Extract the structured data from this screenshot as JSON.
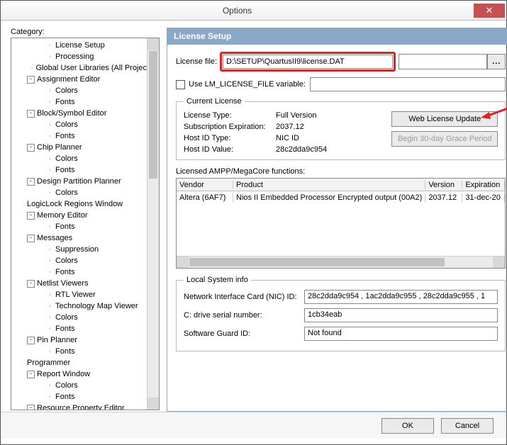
{
  "window": {
    "title": "Options"
  },
  "left": {
    "label": "Category:",
    "items": [
      {
        "level": 3,
        "exp": null,
        "label": "License Setup"
      },
      {
        "level": 3,
        "exp": null,
        "label": "Processing"
      },
      {
        "level": 3,
        "exp": null,
        "label": "Global User Libraries (All Projec"
      },
      {
        "level": 1,
        "exp": "-",
        "label": "Assignment Editor"
      },
      {
        "level": 3,
        "exp": null,
        "label": "Colors"
      },
      {
        "level": 3,
        "exp": null,
        "label": "Fonts"
      },
      {
        "level": 1,
        "exp": "-",
        "label": "Block/Symbol Editor"
      },
      {
        "level": 3,
        "exp": null,
        "label": "Colors"
      },
      {
        "level": 3,
        "exp": null,
        "label": "Fonts"
      },
      {
        "level": 1,
        "exp": "-",
        "label": "Chip Planner"
      },
      {
        "level": 3,
        "exp": null,
        "label": "Colors"
      },
      {
        "level": 3,
        "exp": null,
        "label": "Fonts"
      },
      {
        "level": 1,
        "exp": "-",
        "label": "Design Partition Planner"
      },
      {
        "level": 3,
        "exp": null,
        "label": "Colors"
      },
      {
        "level": 1,
        "exp": null,
        "label": "LogicLock Regions Window"
      },
      {
        "level": 1,
        "exp": "-",
        "label": "Memory Editor"
      },
      {
        "level": 3,
        "exp": null,
        "label": "Fonts"
      },
      {
        "level": 1,
        "exp": "-",
        "label": "Messages"
      },
      {
        "level": 3,
        "exp": null,
        "label": "Suppression"
      },
      {
        "level": 3,
        "exp": null,
        "label": "Colors"
      },
      {
        "level": 3,
        "exp": null,
        "label": "Fonts"
      },
      {
        "level": 1,
        "exp": "-",
        "label": "Netlist Viewers"
      },
      {
        "level": 3,
        "exp": null,
        "label": "RTL Viewer"
      },
      {
        "level": 3,
        "exp": null,
        "label": "Technology Map Viewer"
      },
      {
        "level": 3,
        "exp": null,
        "label": "Colors"
      },
      {
        "level": 3,
        "exp": null,
        "label": "Fonts"
      },
      {
        "level": 1,
        "exp": "-",
        "label": "Pin Planner"
      },
      {
        "level": 3,
        "exp": null,
        "label": "Fonts"
      },
      {
        "level": 1,
        "exp": null,
        "label": "Programmer"
      },
      {
        "level": 1,
        "exp": "-",
        "label": "Report Window"
      },
      {
        "level": 3,
        "exp": null,
        "label": "Colors"
      },
      {
        "level": 3,
        "exp": null,
        "label": "Fonts"
      },
      {
        "level": 1,
        "exp": "-",
        "label": "Resource Property Editor"
      }
    ]
  },
  "panel": {
    "header": "License Setup",
    "licfile_label": "License file:",
    "licfile_value": "D:\\SETUP\\QuartusII9\\license.DAT",
    "browse": "...",
    "uselm_label": "Use LM_LICENSE_FILE variable:",
    "uselm_value": "",
    "curlic": {
      "legend": "Current License",
      "rows": [
        {
          "k": "License Type:",
          "v": "Full Version"
        },
        {
          "k": "Subscription Expiration:",
          "v": "2037.12"
        },
        {
          "k": "Host ID Type:",
          "v": "NIC ID"
        },
        {
          "k": "Host ID Value:",
          "v": "28c2dda9c954"
        }
      ],
      "btn_web": "Web License Update",
      "btn_grace": "Begin 30-day Grace Period"
    },
    "functions_label": "Licensed AMPP/MegaCore functions:",
    "table": {
      "headers": [
        "Vendor",
        "Product",
        "Version",
        "Expiration"
      ],
      "rows": [
        {
          "vendor": "Altera (6AF7)",
          "product": "Nios II Embedded Processor Encrypted output (00A2)",
          "version": "2037.12",
          "exp": "31-dec-20"
        }
      ]
    },
    "local": {
      "legend": "Local System info",
      "rows": [
        {
          "k": "Network Interface Card (NIC) ID:",
          "v": "28c2dda9c954 , 1ac2dda9c955 , 28c2dda9c955 , 1"
        },
        {
          "k": "C: drive serial number:",
          "v": "1cb34eab"
        },
        {
          "k": "Software Guard ID:",
          "v": "Not found"
        }
      ]
    }
  },
  "footer": {
    "ok": "OK",
    "cancel": "Cancel"
  }
}
